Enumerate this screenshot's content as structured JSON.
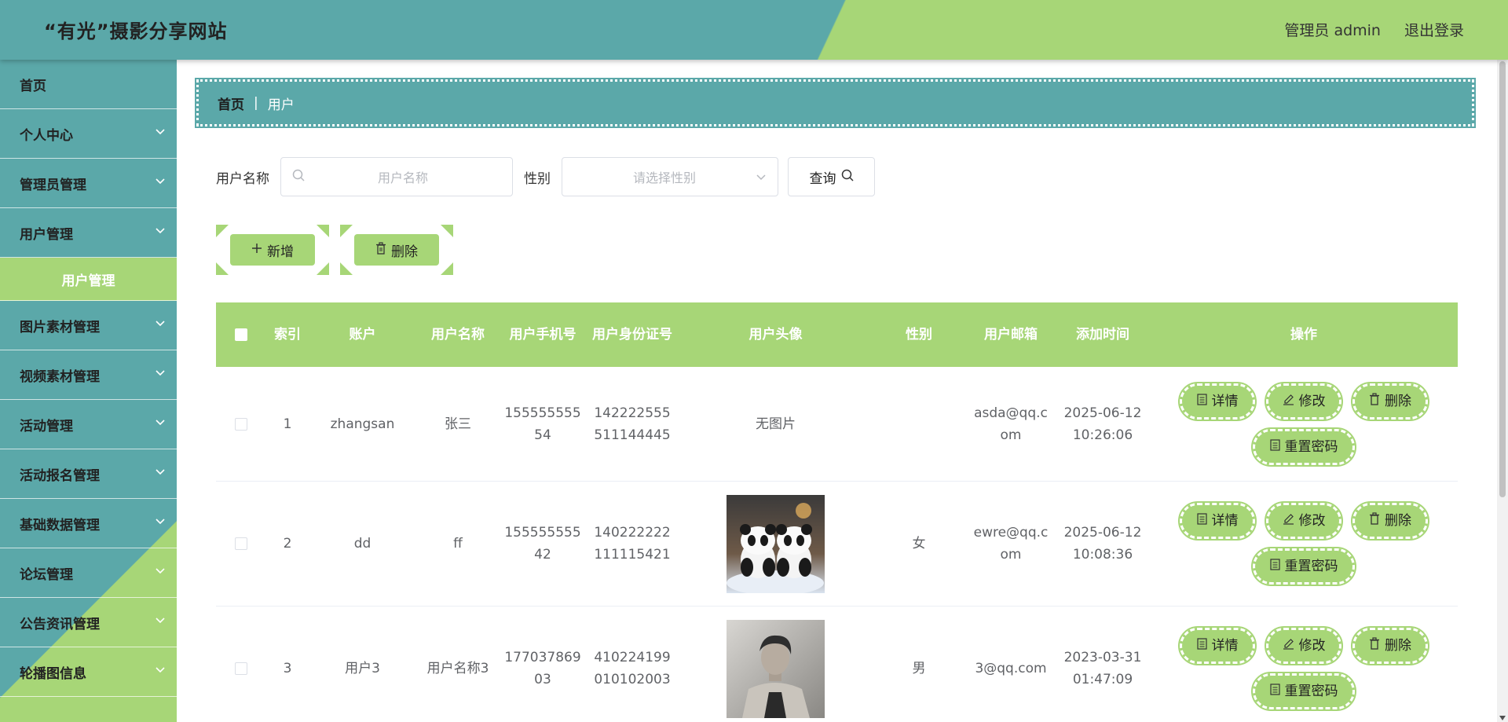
{
  "header": {
    "brand": "“有光”摄影分享网站",
    "admin_label": "管理员 admin",
    "logout_label": "退出登录"
  },
  "sidebar": {
    "items": [
      {
        "label": "首页",
        "has_chevron": false
      },
      {
        "label": "个人中心",
        "has_chevron": true
      },
      {
        "label": "管理员管理",
        "has_chevron": true
      },
      {
        "label": "用户管理",
        "has_chevron": true
      },
      {
        "label": "图片素材管理",
        "has_chevron": true
      },
      {
        "label": "视频素材管理",
        "has_chevron": true
      },
      {
        "label": "活动管理",
        "has_chevron": true
      },
      {
        "label": "活动报名管理",
        "has_chevron": true
      },
      {
        "label": "基础数据管理",
        "has_chevron": true
      },
      {
        "label": "论坛管理",
        "has_chevron": true
      },
      {
        "label": "公告资讯管理",
        "has_chevron": true
      },
      {
        "label": "轮播图信息",
        "has_chevron": true
      }
    ],
    "active_submenu": "用户管理"
  },
  "breadcrumb": {
    "home": "首页",
    "separator": "|",
    "current": "用户"
  },
  "search": {
    "name_label": "用户名称",
    "name_placeholder": "用户名称",
    "gender_label": "性别",
    "gender_placeholder": "请选择性别",
    "query_label": "查询"
  },
  "actions": {
    "add_label": "新增",
    "delete_label": "删除"
  },
  "table": {
    "headers": {
      "index": "索引",
      "account": "账户",
      "name": "用户名称",
      "phone": "用户手机号",
      "idcard": "用户身份证号",
      "avatar": "用户头像",
      "gender": "性别",
      "email": "用户邮箱",
      "time": "添加时间",
      "ops": "操作"
    },
    "rows": [
      {
        "index": "1",
        "account": "zhangsan",
        "name": "张三",
        "phone_a": "155555555",
        "phone_b": "54",
        "id_a": "142222555",
        "id_b": "511144445",
        "avatar": "无图片",
        "gender": "",
        "email_a": "asda@qq.c",
        "email_b": "om",
        "date": "2025-06-12",
        "time": "10:26:06"
      },
      {
        "index": "2",
        "account": "dd",
        "name": "ff",
        "phone_a": "155555555",
        "phone_b": "42",
        "id_a": "140222222",
        "id_b": "111115421",
        "avatar": "panda",
        "gender": "女",
        "email_a": "ewre@qq.c",
        "email_b": "om",
        "date": "2025-06-12",
        "time": "10:08:36"
      },
      {
        "index": "3",
        "account": "用户3",
        "name": "用户名称3",
        "phone_a": "177037869",
        "phone_b": "03",
        "id_a": "410224199",
        "id_b": "010102003",
        "avatar": "portrait",
        "gender": "男",
        "email_a": "3@qq.com",
        "email_b": "",
        "date": "2023-03-31",
        "time": "01:47:09"
      }
    ],
    "op_labels": {
      "detail": "详情",
      "edit": "修改",
      "delete": "删除",
      "reset": "重置密码"
    }
  },
  "colors": {
    "teal": "#5ba8a9",
    "green": "#a7d677"
  }
}
